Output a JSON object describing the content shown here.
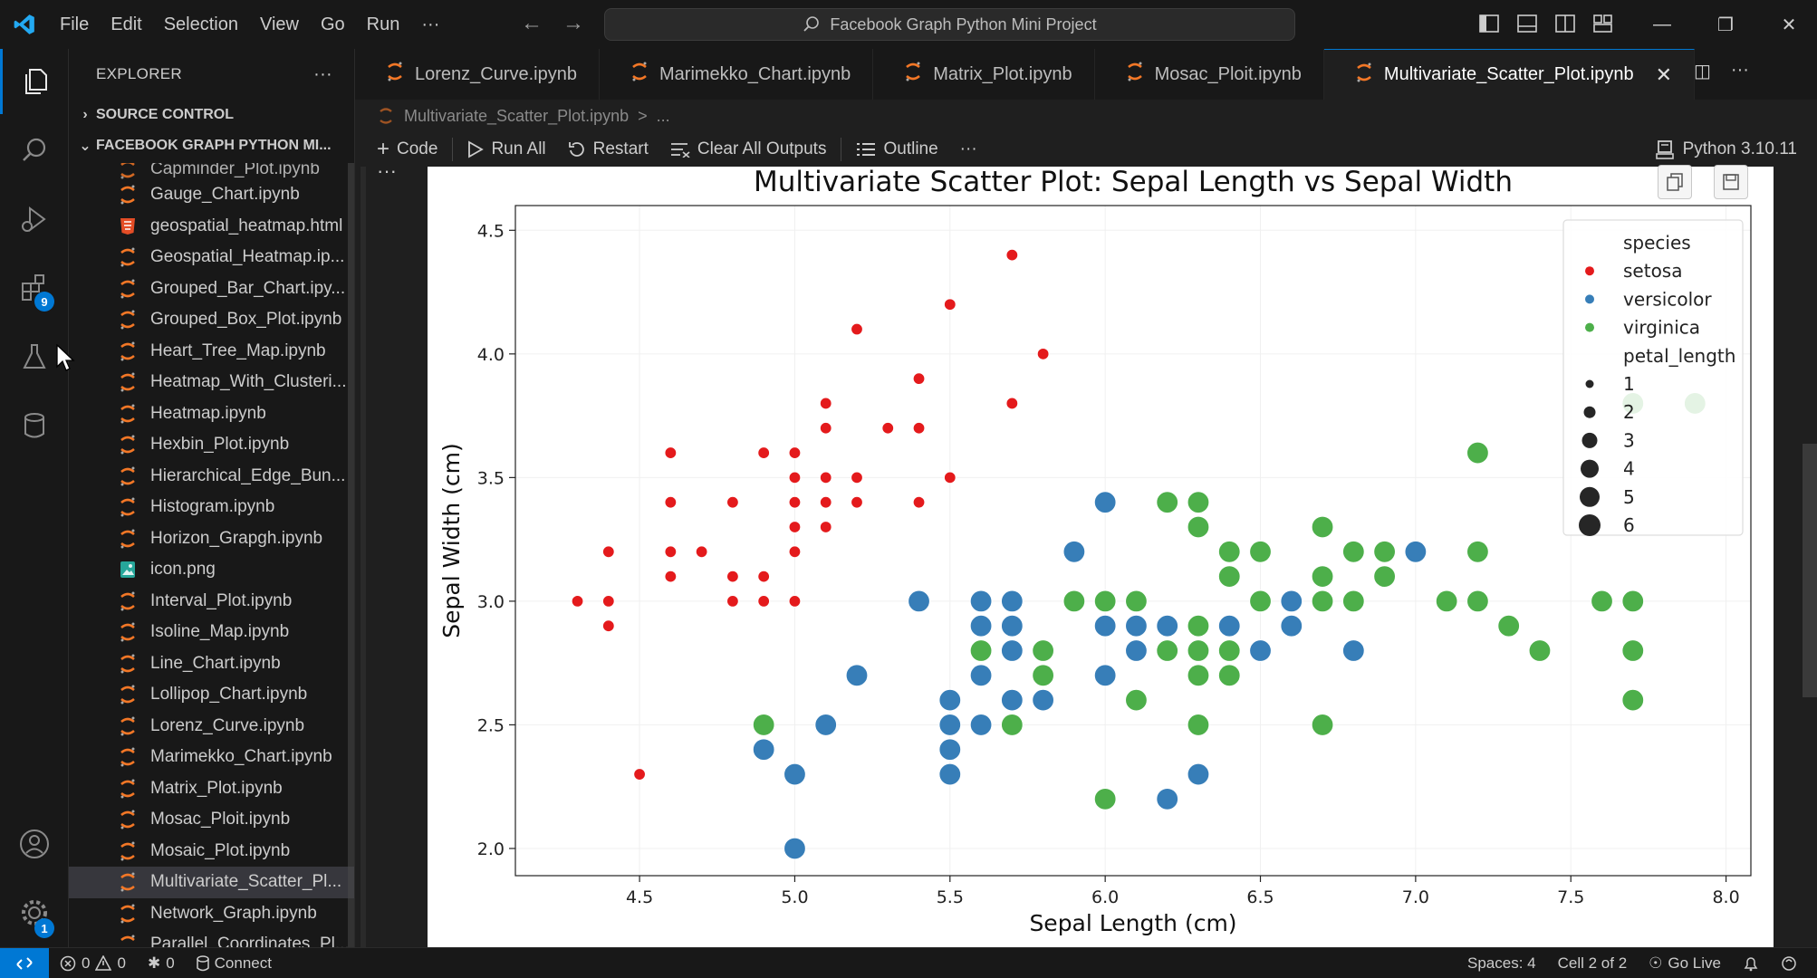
{
  "menu": [
    "File",
    "Edit",
    "Selection",
    "View",
    "Go",
    "Run",
    "···"
  ],
  "command_center": "Facebook Graph Python Mini Project",
  "window_controls": [
    "minimize",
    "restore",
    "close"
  ],
  "activity": {
    "extensions_badge": "9",
    "settings_badge": "1"
  },
  "sidebar": {
    "title": "EXPLORER",
    "more": "···",
    "source_control": "SOURCE CONTROL",
    "folder": "FACEBOOK GRAPH PYTHON MI...",
    "files": [
      {
        "name": "Capminder_Plot.ipynb",
        "type": "ipynb",
        "partial": true
      },
      {
        "name": "Gauge_Chart.ipynb",
        "type": "ipynb"
      },
      {
        "name": "geospatial_heatmap.html",
        "type": "html"
      },
      {
        "name": "Geospatial_Heatmap.ip...",
        "type": "ipynb"
      },
      {
        "name": "Grouped_Bar_Chart.ipy...",
        "type": "ipynb"
      },
      {
        "name": "Grouped_Box_Plot.ipynb",
        "type": "ipynb"
      },
      {
        "name": "Heart_Tree_Map.ipynb",
        "type": "ipynb"
      },
      {
        "name": "Heatmap_With_Clusteri...",
        "type": "ipynb"
      },
      {
        "name": "Heatmap.ipynb",
        "type": "ipynb"
      },
      {
        "name": "Hexbin_Plot.ipynb",
        "type": "ipynb"
      },
      {
        "name": "Hierarchical_Edge_Bun...",
        "type": "ipynb"
      },
      {
        "name": "Histogram.ipynb",
        "type": "ipynb"
      },
      {
        "name": "Horizon_Grapgh.ipynb",
        "type": "ipynb"
      },
      {
        "name": "icon.png",
        "type": "png"
      },
      {
        "name": "Interval_Plot.ipynb",
        "type": "ipynb"
      },
      {
        "name": "Isoline_Map.ipynb",
        "type": "ipynb"
      },
      {
        "name": "Line_Chart.ipynb",
        "type": "ipynb"
      },
      {
        "name": "Lollipop_Chart.ipynb",
        "type": "ipynb"
      },
      {
        "name": "Lorenz_Curve.ipynb",
        "type": "ipynb"
      },
      {
        "name": "Marimekko_Chart.ipynb",
        "type": "ipynb"
      },
      {
        "name": "Matrix_Plot.ipynb",
        "type": "ipynb"
      },
      {
        "name": "Mosac_Ploit.ipynb",
        "type": "ipynb"
      },
      {
        "name": "Mosaic_Plot.ipynb",
        "type": "ipynb"
      },
      {
        "name": "Multivariate_Scatter_Pl...",
        "type": "ipynb",
        "selected": true
      },
      {
        "name": "Network_Graph.ipynb",
        "type": "ipynb"
      },
      {
        "name": "Parallel_Coordinates_Pl...",
        "type": "ipynb"
      }
    ]
  },
  "tabs": [
    {
      "label": "Lorenz_Curve.ipynb"
    },
    {
      "label": "Marimekko_Chart.ipynb"
    },
    {
      "label": "Matrix_Plot.ipynb"
    },
    {
      "label": "Mosac_Ploit.ipynb"
    },
    {
      "label": "Multivariate_Scatter_Plot.ipynb",
      "active": true
    }
  ],
  "breadcrumb": {
    "file": "Multivariate_Scatter_Plot.ipynb",
    "sep": ">",
    "rest": "..."
  },
  "toolbar": {
    "code": "Code",
    "run_all": "Run All",
    "restart": "Restart",
    "clear": "Clear All Outputs",
    "outline": "Outline",
    "more": "···",
    "kernel": "Python 3.10.11"
  },
  "cell_more": "···",
  "status": {
    "errors": "0",
    "warnings": "0",
    "ports": "0",
    "connect": "Connect",
    "spaces": "Spaces: 4",
    "cell": "Cell 2 of 2",
    "golive": "Go Live"
  },
  "colors": {
    "accent": "#0078d4",
    "setosa": "#e41a1c",
    "versicolor": "#377eb8",
    "virginica": "#4daf4a"
  },
  "chart_data": {
    "type": "scatter",
    "title": "Multivariate Scatter Plot: Sepal Length vs Sepal Width",
    "xlabel": "Sepal Length (cm)",
    "ylabel": "Sepal Width (cm)",
    "xlim": [
      4.1,
      8.08
    ],
    "ylim": [
      1.89,
      4.6
    ],
    "xticks": [
      "4.5",
      "5.0",
      "5.5",
      "6.0",
      "6.5",
      "7.0",
      "7.5",
      "8.0"
    ],
    "yticks": [
      "2.0",
      "2.5",
      "3.0",
      "3.5",
      "4.0",
      "4.5"
    ],
    "legend": {
      "position": "upper right",
      "hue_title": "species",
      "size_title": "petal_length",
      "size_labels": [
        "1",
        "2",
        "3",
        "4",
        "5",
        "6"
      ]
    },
    "series": [
      {
        "name": "setosa",
        "color": "#e41a1c",
        "points": [
          [
            4.3,
            3.0
          ],
          [
            4.4,
            3.2
          ],
          [
            4.4,
            3.0
          ],
          [
            4.4,
            2.9
          ],
          [
            4.5,
            2.3
          ],
          [
            4.6,
            3.6
          ],
          [
            4.6,
            3.4
          ],
          [
            4.6,
            3.2
          ],
          [
            4.6,
            3.1
          ],
          [
            4.7,
            3.2
          ],
          [
            4.8,
            3.4
          ],
          [
            4.8,
            3.1
          ],
          [
            4.8,
            3.0
          ],
          [
            4.9,
            3.6
          ],
          [
            4.9,
            3.1
          ],
          [
            4.9,
            3.0
          ],
          [
            5.0,
            3.6
          ],
          [
            5.0,
            3.5
          ],
          [
            5.0,
            3.4
          ],
          [
            5.0,
            3.3
          ],
          [
            5.0,
            3.2
          ],
          [
            5.0,
            3.0
          ],
          [
            5.1,
            3.8
          ],
          [
            5.1,
            3.7
          ],
          [
            5.1,
            3.5
          ],
          [
            5.1,
            3.4
          ],
          [
            5.1,
            3.3
          ],
          [
            5.2,
            4.1
          ],
          [
            5.2,
            3.5
          ],
          [
            5.2,
            3.4
          ],
          [
            5.3,
            3.7
          ],
          [
            5.4,
            3.9
          ],
          [
            5.4,
            3.7
          ],
          [
            5.4,
            3.4
          ],
          [
            5.5,
            4.2
          ],
          [
            5.5,
            3.5
          ],
          [
            5.7,
            4.4
          ],
          [
            5.7,
            3.8
          ],
          [
            5.8,
            4.0
          ]
        ]
      },
      {
        "name": "versicolor",
        "color": "#377eb8",
        "points": [
          [
            4.9,
            2.4
          ],
          [
            5.0,
            2.3
          ],
          [
            5.0,
            2.0
          ],
          [
            5.1,
            2.5
          ],
          [
            5.2,
            2.7
          ],
          [
            5.4,
            3.0
          ],
          [
            5.5,
            2.6
          ],
          [
            5.5,
            2.5
          ],
          [
            5.5,
            2.4
          ],
          [
            5.5,
            2.3
          ],
          [
            5.6,
            3.0
          ],
          [
            5.6,
            2.9
          ],
          [
            5.6,
            2.7
          ],
          [
            5.6,
            2.5
          ],
          [
            5.7,
            3.0
          ],
          [
            5.7,
            2.9
          ],
          [
            5.7,
            2.8
          ],
          [
            5.7,
            2.6
          ],
          [
            5.8,
            2.6
          ],
          [
            5.8,
            2.7
          ],
          [
            5.9,
            3.2
          ],
          [
            6.0,
            3.4
          ],
          [
            6.0,
            2.9
          ],
          [
            6.0,
            2.7
          ],
          [
            6.1,
            3.0
          ],
          [
            6.1,
            2.9
          ],
          [
            6.1,
            2.8
          ],
          [
            6.2,
            2.9
          ],
          [
            6.2,
            2.2
          ],
          [
            6.3,
            3.3
          ],
          [
            6.3,
            2.5
          ],
          [
            6.3,
            2.3
          ],
          [
            6.4,
            2.9
          ],
          [
            6.5,
            2.8
          ],
          [
            6.6,
            3.0
          ],
          [
            6.6,
            2.9
          ],
          [
            6.7,
            3.1
          ],
          [
            6.7,
            3.0
          ],
          [
            6.8,
            2.8
          ],
          [
            6.9,
            3.1
          ],
          [
            7.0,
            3.2
          ]
        ]
      },
      {
        "name": "virginica",
        "color": "#4daf4a",
        "points": [
          [
            4.9,
            2.5
          ],
          [
            5.6,
            2.8
          ],
          [
            5.7,
            2.5
          ],
          [
            5.8,
            2.8
          ],
          [
            5.8,
            2.7
          ],
          [
            5.9,
            3.0
          ],
          [
            6.0,
            3.0
          ],
          [
            6.0,
            2.2
          ],
          [
            6.1,
            3.0
          ],
          [
            6.1,
            2.6
          ],
          [
            6.2,
            3.4
          ],
          [
            6.2,
            2.8
          ],
          [
            6.3,
            3.4
          ],
          [
            6.3,
            3.3
          ],
          [
            6.3,
            2.9
          ],
          [
            6.3,
            2.8
          ],
          [
            6.3,
            2.7
          ],
          [
            6.3,
            2.5
          ],
          [
            6.4,
            3.2
          ],
          [
            6.4,
            3.1
          ],
          [
            6.4,
            2.8
          ],
          [
            6.4,
            2.7
          ],
          [
            6.5,
            3.2
          ],
          [
            6.5,
            3.0
          ],
          [
            6.7,
            3.3
          ],
          [
            6.7,
            3.1
          ],
          [
            6.7,
            3.0
          ],
          [
            6.7,
            2.5
          ],
          [
            6.8,
            3.2
          ],
          [
            6.8,
            3.0
          ],
          [
            6.9,
            3.2
          ],
          [
            6.9,
            3.1
          ],
          [
            7.1,
            3.0
          ],
          [
            7.2,
            3.6
          ],
          [
            7.2,
            3.2
          ],
          [
            7.2,
            3.0
          ],
          [
            7.3,
            2.9
          ],
          [
            7.4,
            2.8
          ],
          [
            7.6,
            3.0
          ],
          [
            7.7,
            3.8
          ],
          [
            7.7,
            3.0
          ],
          [
            7.7,
            2.8
          ],
          [
            7.7,
            2.6
          ],
          [
            7.9,
            3.8
          ]
        ]
      }
    ]
  }
}
